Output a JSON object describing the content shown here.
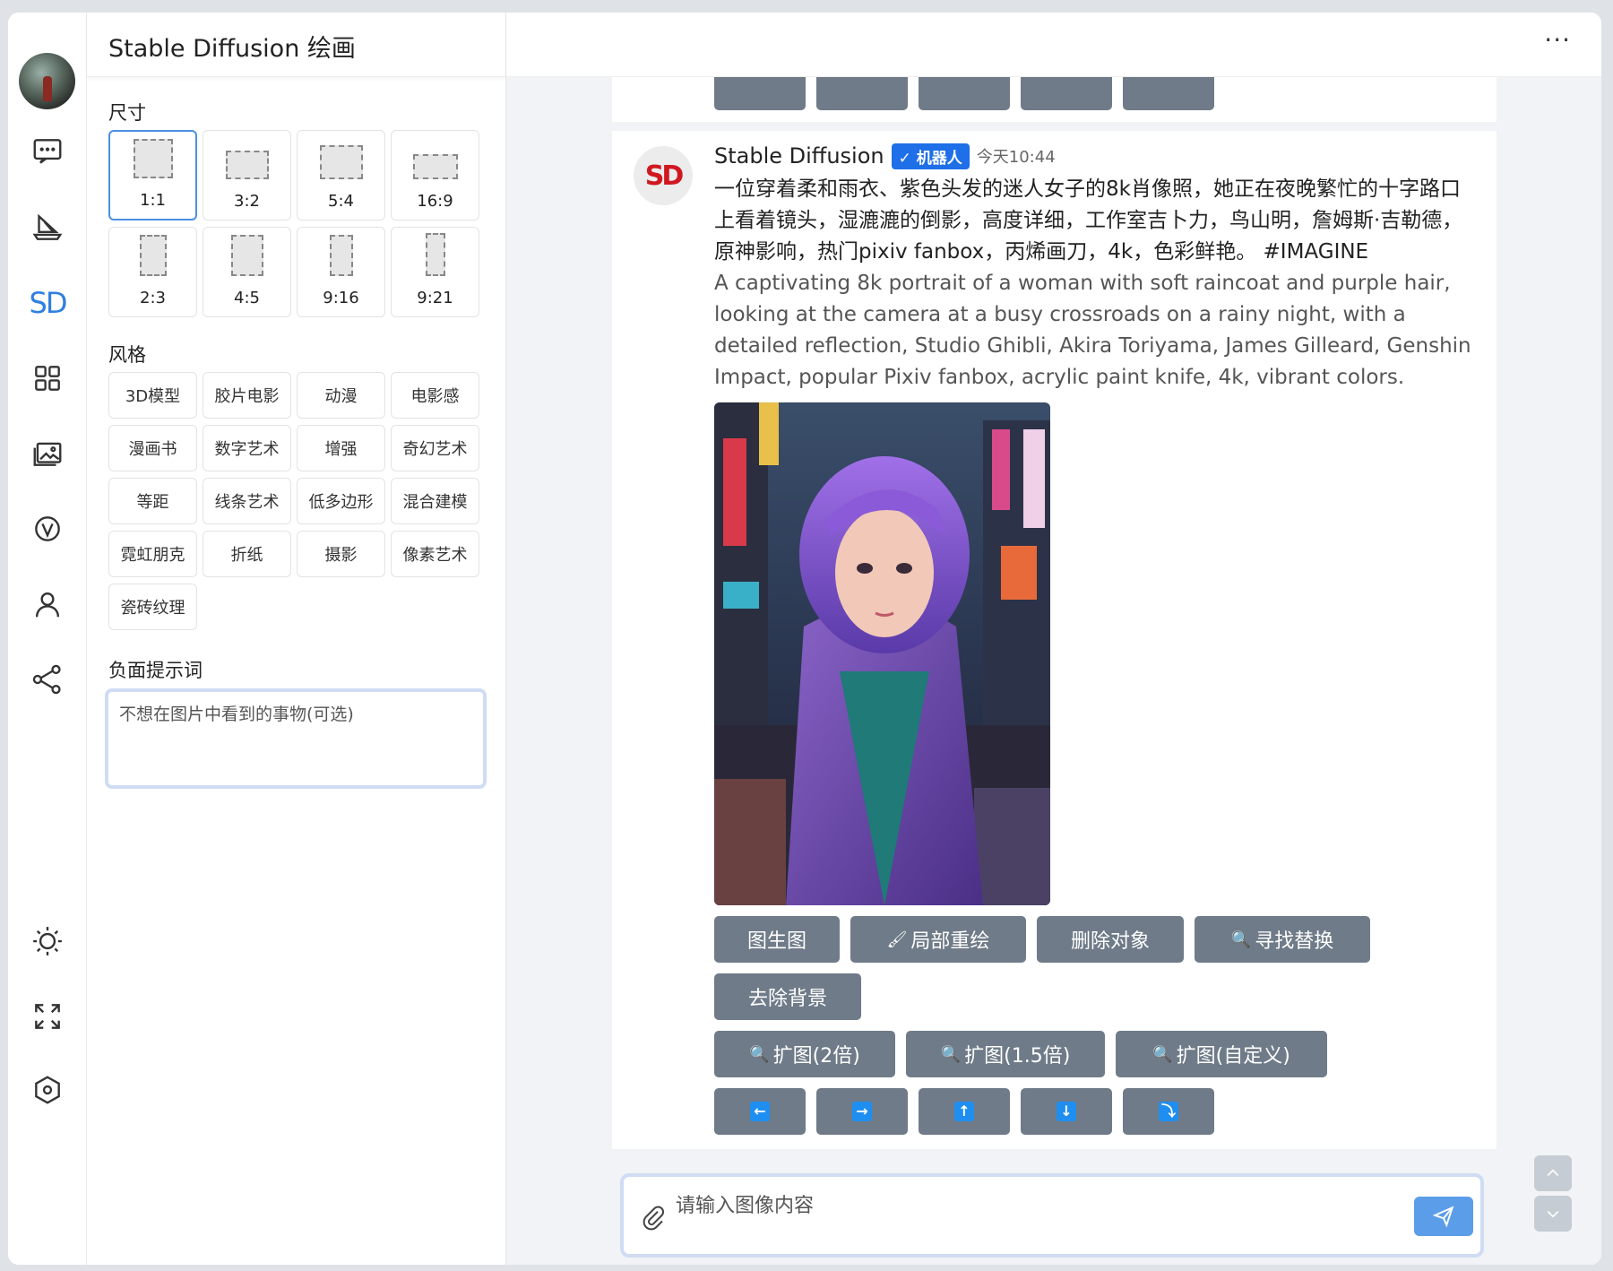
{
  "panel": {
    "title": "Stable Diffusion 绘画",
    "size_label": "尺寸",
    "sizes": [
      "1:1",
      "3:2",
      "5:4",
      "16:9",
      "2:3",
      "4:5",
      "9:16",
      "9:21"
    ],
    "selected_size": "1:1",
    "style_label": "风格",
    "styles": [
      "3D模型",
      "胶片电影",
      "动漫",
      "电影感",
      "漫画书",
      "数字艺术",
      "增强",
      "奇幻艺术",
      "等距",
      "线条艺术",
      "低多边形",
      "混合建模",
      "霓虹朋克",
      "折纸",
      "摄影",
      "像素艺术",
      "瓷砖纹理"
    ],
    "negative_label": "负面提示词",
    "negative_placeholder": "不想在图片中看到的事物(可选)"
  },
  "rail": {
    "icons": [
      "chat-icon",
      "sailboat-icon",
      "sd-icon",
      "apps-grid-icon",
      "gallery-icon",
      "v-icon",
      "user-icon",
      "share-icon",
      "brightness-icon",
      "fullscreen-icon",
      "settings-hex-icon"
    ],
    "sd_text": "SD"
  },
  "message": {
    "avatar_text": "SD",
    "bot_name": "Stable Diffusion",
    "badge": "机器人",
    "time": "今天10:44",
    "text_zh": "一位穿着柔和雨衣、紫色头发的迷人女子的8k肖像照，她正在夜晚繁忙的十字路口上看着镜头，湿漉漉的倒影，高度详细，工作室吉卜力，鸟山明，詹姆斯·吉勒德，原神影响，热门pixiv fanbox，丙烯画刀，4k，色彩鲜艳。 #IMAGINE",
    "text_en": "A captivating 8k portrait of a woman with soft raincoat and purple hair, looking at the camera at a busy crossroads on a rainy night, with a detailed reflection, Studio Ghibli, Akira Toriyama, James Gilleard, Genshin Impact, popular Pixiv fanbox, acrylic paint knife, 4k, vibrant colors.",
    "actions_row1": [
      {
        "label": "图生图",
        "icon": ""
      },
      {
        "label": "局部重绘",
        "icon": "🖌"
      },
      {
        "label": "删除对象",
        "icon": ""
      },
      {
        "label": "寻找替换",
        "icon": "🔍"
      }
    ],
    "actions_row2": [
      {
        "label": "去除背景",
        "icon": ""
      }
    ],
    "actions_row3": [
      {
        "label": "扩图(2倍)",
        "icon": "🔍"
      },
      {
        "label": "扩图(1.5倍)",
        "icon": "🔍"
      },
      {
        "label": "扩图(自定义)",
        "icon": "🔍"
      }
    ],
    "arrow_buttons": [
      {
        "name": "arrow-left-button",
        "glyph": "←"
      },
      {
        "name": "arrow-right-button",
        "glyph": "→"
      },
      {
        "name": "arrow-up-button",
        "glyph": "↑"
      },
      {
        "name": "arrow-down-button",
        "glyph": "↓"
      },
      {
        "name": "arrow-turn-button",
        "glyph": "⤵"
      }
    ]
  },
  "input": {
    "placeholder": "请输入图像内容"
  },
  "colors": {
    "accent": "#2f7fe0",
    "button": "#6f7b88",
    "badge": "#1e6fe8",
    "send": "#5b9de8"
  }
}
